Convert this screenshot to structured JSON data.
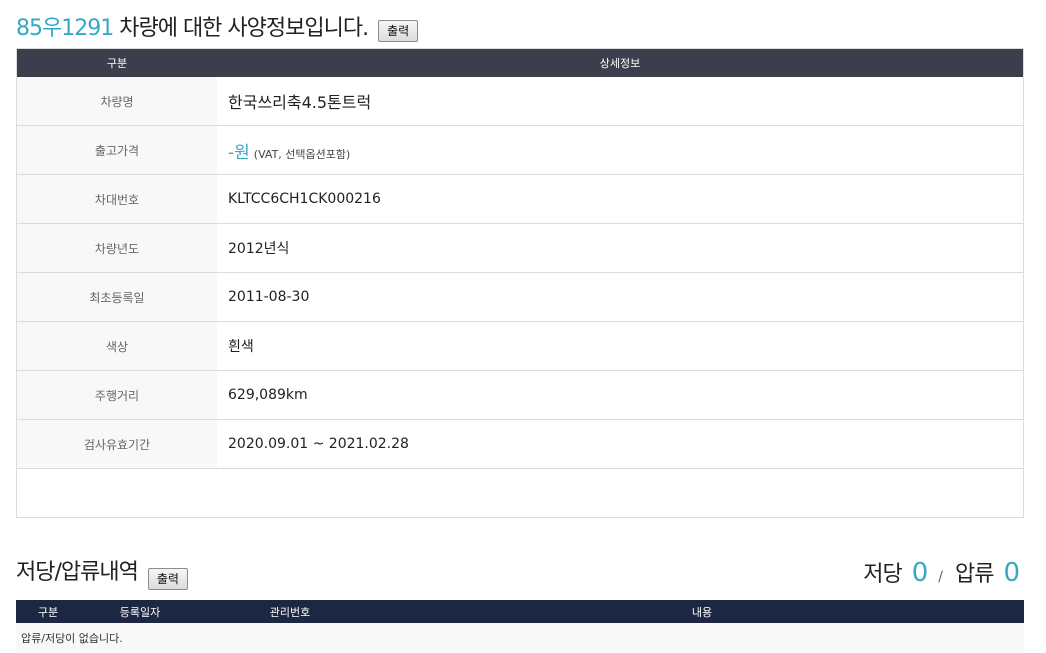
{
  "spec": {
    "plate": "85우1291",
    "title_suffix": " 차량에 대한 사양정보입니다.",
    "print_label": "출력",
    "header": {
      "col1": "구분",
      "col2": "상세정보"
    },
    "rows": [
      {
        "label": "차량명",
        "value": "한국쓰리축4.5톤트럭"
      },
      {
        "label": "출고가격",
        "price": "-원",
        "note": "(VAT, 선택옵션포함)"
      },
      {
        "label": "차대번호",
        "value": "KLTCC6CH1CK000216"
      },
      {
        "label": "차량년도",
        "value": "2012년식"
      },
      {
        "label": "최초등록일",
        "value": "2011-08-30"
      },
      {
        "label": "색상",
        "value": "흰색"
      },
      {
        "label": "주행거리",
        "value": "629,089km"
      },
      {
        "label": "검사유효기간",
        "value": "2020.09.01 ~ 2021.02.28"
      }
    ]
  },
  "lien": {
    "title": "저당/압류내역",
    "print_label": "출력",
    "mortgage_label": "저당",
    "mortgage_count": "0",
    "separator": "/",
    "seizure_label": "압류",
    "seizure_count": "0",
    "columns": [
      "구분",
      "등록일자",
      "관리번호",
      "내용"
    ],
    "empty_message": "압류/저당이 없습니다."
  },
  "colors": {
    "accent": "#35a9c4",
    "table_header": "#3a3f4b",
    "lien_header": "#1c2743"
  }
}
